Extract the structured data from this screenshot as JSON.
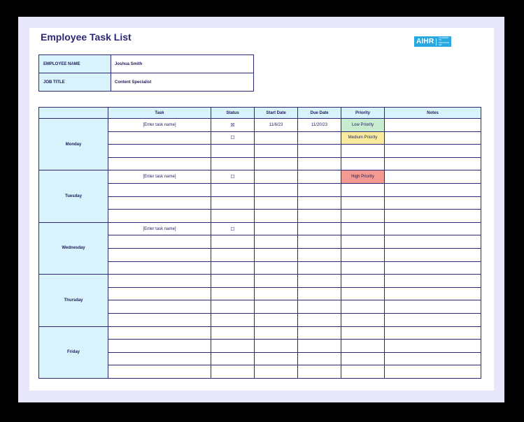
{
  "title": "Employee Task List",
  "logo": {
    "text": "AIHR",
    "tagline": "ACADEMY TO INNOVATE HR"
  },
  "info": {
    "name_label": "EMPLOYEE NAME",
    "name_value": "Joshua Smith",
    "job_label": "JOB TITLE",
    "job_value": "Content Specialist"
  },
  "headers": [
    "",
    "Task",
    "Status",
    "Start Date",
    "Due Date",
    "Priority",
    "Notes"
  ],
  "days": [
    "Monday",
    "Tuesday",
    "Wednesday",
    "Thursday",
    "Friday"
  ],
  "rows": {
    "monday_1": {
      "task": "[Enter task name]",
      "status": "☒",
      "start": "11/6/23",
      "due": "11/20/23",
      "priority": "Low Priority"
    },
    "monday_2": {
      "status": "☐",
      "priority": "Medium Priority"
    },
    "tuesday_1": {
      "task": "[Enter task name]",
      "status": "☐",
      "priority": "High Priority"
    },
    "wednesday_1": {
      "task": "[Enter task name]",
      "status": "☐"
    }
  },
  "colors": {
    "accent": "#2b2875",
    "header_bg": "#d8f3fb",
    "low": "#c7ecd0",
    "medium": "#f9eca0",
    "high": "#f39a92",
    "logo": "#2aa9e0"
  }
}
